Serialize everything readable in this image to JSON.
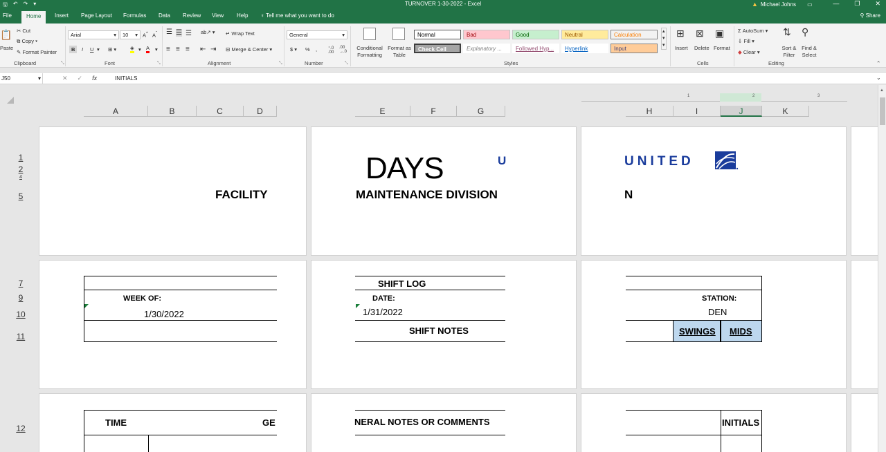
{
  "titlebar": {
    "title": "TURNOVER 1-30-2022  -  Excel",
    "user": "Michael Johns",
    "quick_access": [
      "save",
      "undo",
      "redo",
      "customize"
    ]
  },
  "ribbon_tabs": [
    "File",
    "Home",
    "Insert",
    "Page Layout",
    "Formulas",
    "Data",
    "Review",
    "View",
    "Help"
  ],
  "active_tab": "Home",
  "tell_me": "Tell me what you want to do",
  "share": "Share",
  "clipboard": {
    "cut": "Cut",
    "copy": "Copy",
    "format_painter": "Format Painter",
    "paste": "Paste",
    "label": "Clipboard"
  },
  "font": {
    "name": "Arial",
    "size": "10",
    "bold": "B",
    "italic": "I",
    "underline": "U",
    "label": "Font"
  },
  "alignment": {
    "wrap_text": "Wrap Text",
    "merge_center": "Merge & Center",
    "label": "Alignment"
  },
  "number": {
    "format": "General",
    "currency": "$",
    "percent": "%",
    "comma": ",",
    "label": "Number"
  },
  "styles": {
    "conditional_formatting": "Conditional Formatting",
    "format_as_table": "Format as Table",
    "cells": [
      {
        "label": "Normal",
        "bg": "#ffffff",
        "fg": "#000000"
      },
      {
        "label": "Bad",
        "bg": "#ffc7ce",
        "fg": "#9c0006"
      },
      {
        "label": "Good",
        "bg": "#c6efce",
        "fg": "#006100"
      },
      {
        "label": "Neutral",
        "bg": "#ffeb9c",
        "fg": "#9c5700"
      },
      {
        "label": "Calculation",
        "bg": "#f2f2f2",
        "fg": "#fa7d00"
      },
      {
        "label": "Check Cell",
        "bg": "#a5a5a5",
        "fg": "#ffffff"
      },
      {
        "label": "Explanatory ...",
        "bg": "#ffffff",
        "fg": "#7f7f7f"
      },
      {
        "label": "Followed Hyp...",
        "bg": "#ffffff",
        "fg": "#954f72"
      },
      {
        "label": "Hyperlink",
        "bg": "#ffffff",
        "fg": "#0563c1"
      },
      {
        "label": "Input",
        "bg": "#ffcc99",
        "fg": "#3f3f76"
      }
    ],
    "label": "Styles"
  },
  "cells_group": {
    "insert": "Insert",
    "delete": "Delete",
    "format": "Format",
    "label": "Cells"
  },
  "editing": {
    "autosum": "AutoSum",
    "fill": "Fill",
    "clear": "Clear",
    "sort_filter": "Sort & Filter",
    "find_select": "Find & Select",
    "label": "Editing"
  },
  "formula_bar": {
    "name_box": "J50",
    "cancel": "✕",
    "enter": "✓",
    "fx": "fx",
    "value": "INITIALS"
  },
  "column_headers": [
    "A",
    "B",
    "C",
    "D",
    "E",
    "F",
    "G",
    "H",
    "I",
    "J",
    "K"
  ],
  "selected_column": "J",
  "row_headers": [
    "1",
    "2",
    "4",
    "5",
    "7",
    "9",
    "10",
    "11",
    "12"
  ],
  "ruler_numbers": [
    "1",
    "2",
    "3"
  ],
  "sheet": {
    "days": "DAYS",
    "facility": "FACILITY",
    "maintenance_division": "MAINTENANCE DIVISION",
    "n_fragment": "N",
    "united_fragment_left": "U",
    "united_logo": "UNITED",
    "shift_log": "SHIFT LOG",
    "week_of_label": "WEEK OF:",
    "week_of_value": "1/30/2022",
    "date_label": "DATE:",
    "date_value": "1/31/2022",
    "station_label": "STATION:",
    "station_value": "DEN",
    "shift_notes": "SHIFT NOTES",
    "swings": "SWINGS",
    "mids": "MIDS",
    "time": "TIME",
    "ge_fragment": "GE",
    "general_notes": "NERAL NOTES OR COMMENTS",
    "initials": "INITIALS"
  }
}
